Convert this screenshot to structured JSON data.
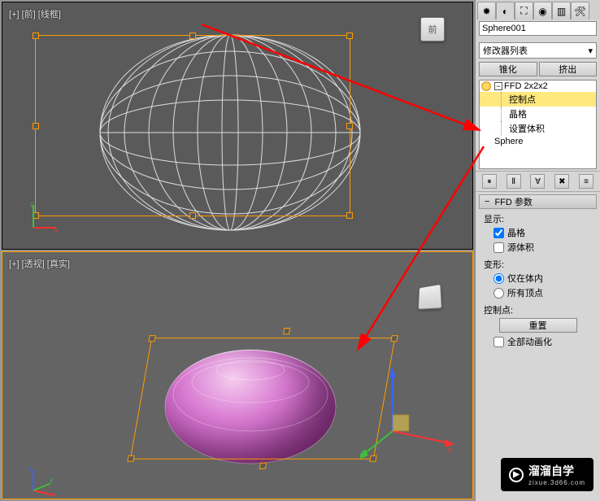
{
  "viewport_top_label": "[+] [前] [线框]",
  "viewport_bottom_label": "[+] [透视] [真实]",
  "gizmo_front": "前",
  "toolbar_icons": [
    "✹",
    "◐",
    "⬚",
    "∿",
    "⬒",
    "◎",
    "▥",
    "⬚"
  ],
  "object_name": "Sphere001",
  "modifier_list_label": "修改器列表",
  "mod_btn_left": "锥化",
  "mod_btn_right": "挤出",
  "stack": {
    "top": "FFD 2x2x2",
    "sub": [
      "控制点",
      "晶格",
      "设置体积"
    ],
    "base": "Sphere"
  },
  "rollout_title": "FFD 参数",
  "group_display": "显示:",
  "opt_lattice": "晶格",
  "opt_sourcevol": "源体积",
  "group_deform": "变形:",
  "opt_inside": "仅在体内",
  "opt_allverts": "所有顶点",
  "group_cp": "控制点:",
  "btn_reset": "重置",
  "chk_allanim": "全部动画化",
  "watermark_text": "溜溜自学",
  "watermark_url": "zixue.3d66.com"
}
